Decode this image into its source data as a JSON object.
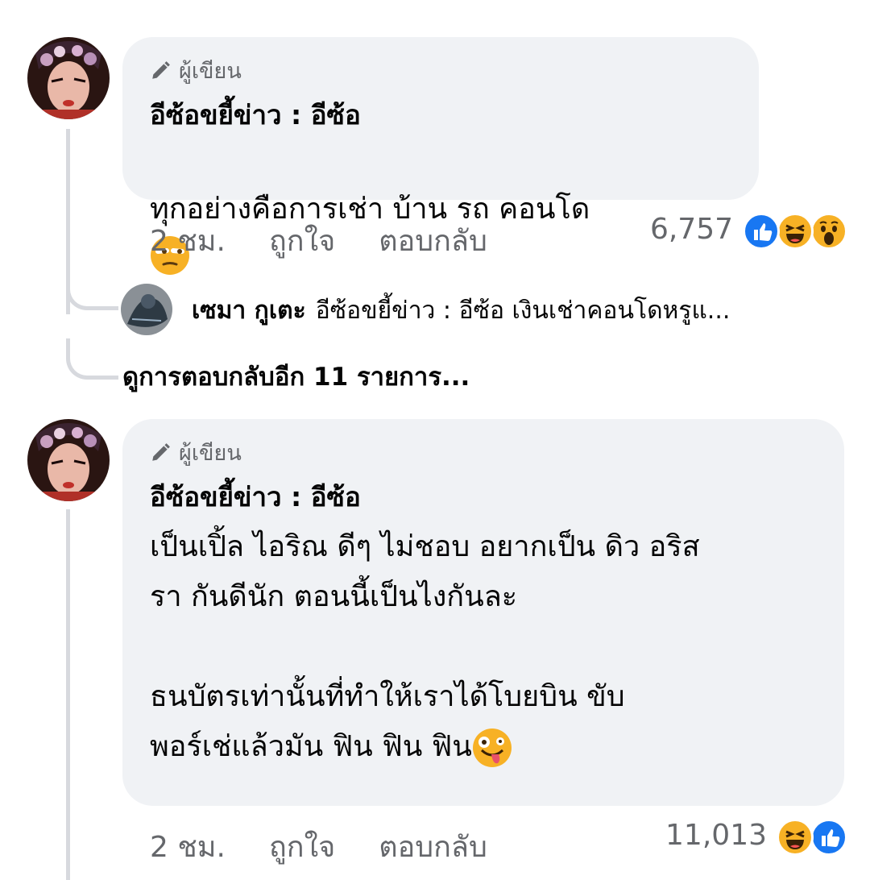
{
  "comments": [
    {
      "author_badge": "ผู้เขียน",
      "name": "อีซ้อขยี้ข่าว : อีซ้อ",
      "text": "ทุกอย่างคือการเช่า บ้าน รถ คอนโด",
      "text_emoji": "unamused-face-emoji",
      "time": "2 ชม.",
      "like_label": "ถูกใจ",
      "reply_label": "ตอบกลับ",
      "reaction_count": "6,757",
      "reactions": [
        "like",
        "haha",
        "wow"
      ]
    },
    {
      "author_badge": "ผู้เขียน",
      "name": "อีซ้อขยี้ข่าว : อีซ้อ",
      "text": "เป็นเปิ้ล ไอริณ ดีๆ ไม่ชอบ อยากเป็น ดิว อริส\nรา กันดีนัก ตอนนี้เป็นไงกันละ\n\nธนบัตรเท่านั้นที่ทำให้เราได้โบยบิน ขับ\nพอร์เช่แล้วมัน ฟิน ฟิน ฟิน",
      "text_emoji": "zany-face-emoji",
      "time": "2 ชม.",
      "like_label": "ถูกใจ",
      "reply_label": "ตอบกลับ",
      "reaction_count": "11,013",
      "reactions": [
        "haha",
        "like"
      ]
    }
  ],
  "reply": {
    "name": "เซมา กูเตะ",
    "preview": "อีซ้อขยี้ข่าว : อีซ้อ เงินเช่าคอนโดหรูแ..."
  },
  "more_replies": "ดูการตอบกลับอีก 11 รายการ...",
  "colors": {
    "bubble": "#f0f2f5",
    "secondary_text": "#65676b",
    "like_blue": "#1877f2",
    "emoji_yellow": "#f7b125"
  }
}
